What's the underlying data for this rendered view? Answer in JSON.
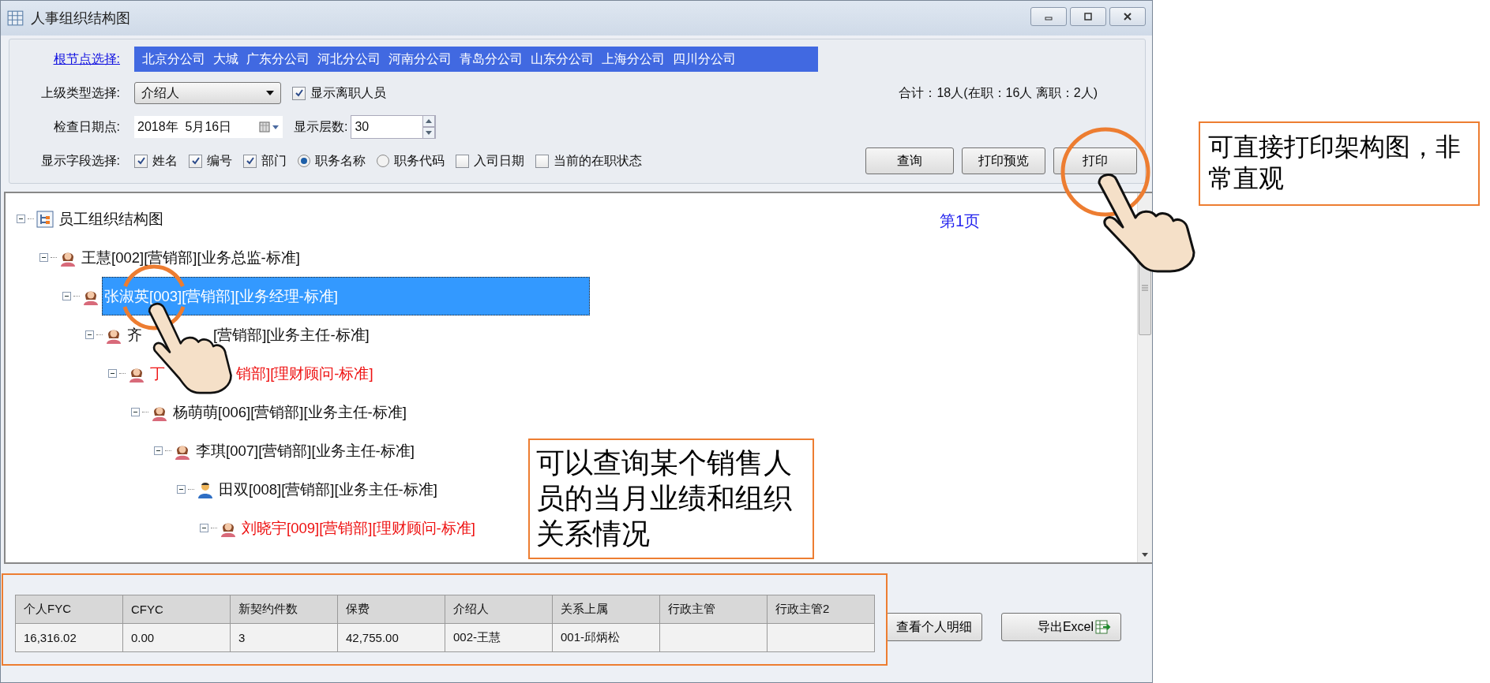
{
  "window": {
    "title": "人事组织结构图"
  },
  "filters": {
    "root_label": "根节点选择:",
    "branches": [
      "北京分公司",
      "大城",
      "广东分公司",
      "河北分公司",
      "河南分公司",
      "青岛分公司",
      "山东分公司",
      "上海分公司",
      "四川分公司"
    ],
    "superior_type": {
      "label": "上级类型选择:",
      "value": "介绍人"
    },
    "show_resigned": {
      "label": "显示离职人员",
      "checked": true
    },
    "summary": "合计：18人(在职：16人 离职：2人)",
    "check_date": {
      "label": "检查日期点:",
      "value": "2018年  5月16日"
    },
    "levels": {
      "label": "显示层数:",
      "value": "30"
    },
    "fields_label": "显示字段选择:",
    "fields": [
      {
        "kind": "checkbox",
        "label": "姓名",
        "checked": true
      },
      {
        "kind": "checkbox",
        "label": "编号",
        "checked": true
      },
      {
        "kind": "checkbox",
        "label": "部门",
        "checked": true
      },
      {
        "kind": "radio",
        "label": "职务名称",
        "selected": true
      },
      {
        "kind": "radio",
        "label": "职务代码",
        "selected": false
      },
      {
        "kind": "checkbox",
        "label": "入司日期",
        "checked": false
      },
      {
        "kind": "checkbox",
        "label": "当前的在职状态",
        "checked": false
      }
    ],
    "buttons": [
      "查询",
      "打印预览",
      "打印"
    ]
  },
  "tree": {
    "page_label": "第1页",
    "root": {
      "kind": "chart",
      "text": "员工组织结构图",
      "expanded": true,
      "selected": false,
      "resigned": false,
      "children": [
        {
          "kind": "female",
          "text": "王慧[002][营销部][业务总监-标准]",
          "expanded": true,
          "selected": false,
          "resigned": false,
          "children": [
            {
              "kind": "female",
              "text": "张淑英[003][营销部][业务经理-标准]",
              "expanded": true,
              "selected": true,
              "resigned": false,
              "children": [
                {
                  "kind": "female",
                  "text": "齐",
                  "text_after": "[营销部][业务主任-标准]",
                  "expanded": true,
                  "selected": false,
                  "resigned": false,
                  "children": [
                    {
                      "kind": "female",
                      "text": "丁",
                      "text_after": "销部][理财顾问-标准]",
                      "expanded": true,
                      "selected": false,
                      "resigned": true,
                      "children": [
                        {
                          "kind": "female",
                          "text": "杨萌萌[006][营销部][业务主任-标准]",
                          "expanded": true,
                          "selected": false,
                          "resigned": false,
                          "children": [
                            {
                              "kind": "female",
                              "text": "李琪[007][营销部][业务主任-标准]",
                              "expanded": true,
                              "selected": false,
                              "resigned": false,
                              "children": [
                                {
                                  "kind": "male",
                                  "text": "田双[008][营销部][业务主任-标准]",
                                  "expanded": true,
                                  "selected": false,
                                  "resigned": false,
                                  "children": [
                                    {
                                      "kind": "female",
                                      "text": "刘晓宇[009][营销部][理财顾问-标准]",
                                      "expanded": true,
                                      "selected": false,
                                      "resigned": true
                                    }
                                  ]
                                }
                              ]
                            }
                          ]
                        }
                      ]
                    }
                  ]
                }
              ]
            }
          ]
        }
      ]
    }
  },
  "table": {
    "columns": [
      "个人FYC",
      "CFYC",
      "新契约件数",
      "保费",
      "介绍人",
      "关系上属",
      "行政主管",
      "行政主管2"
    ],
    "rows": [
      [
        "16,316.02",
        "0.00",
        "3",
        "42,755.00",
        "002-王慧",
        "001-邱炳松",
        "",
        ""
      ]
    ]
  },
  "detail_buttons": [
    {
      "kind": "plain",
      "label": "查看个人明细"
    },
    {
      "kind": "excel",
      "label": "导出Excel"
    }
  ],
  "annotations": [
    {
      "text": "可直接打印架构图，非常直观"
    },
    {
      "text": "可以查询某个销售人员的当月业绩和组织关系情况"
    }
  ]
}
